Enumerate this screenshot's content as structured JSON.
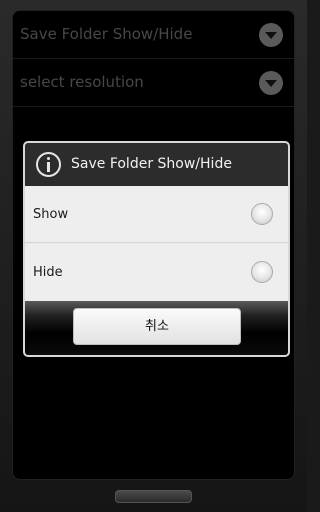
{
  "preferences": {
    "items": [
      {
        "label": "Save Folder Show/Hide",
        "icon": "dropdown-arrow-icon"
      },
      {
        "label": "select resolution",
        "icon": "dropdown-arrow-icon"
      }
    ]
  },
  "dialog": {
    "title": "Save Folder Show/Hide",
    "title_icon": "info-icon",
    "options": [
      {
        "label": "Show",
        "selected": false
      },
      {
        "label": "Hide",
        "selected": false
      }
    ],
    "cancel_label": "취소"
  },
  "colors": {
    "screen_background": "#000000",
    "pref_text": "#6e6e6e",
    "dialog_title_bar": "#2c2c2c",
    "dialog_body": "#eeeeee"
  }
}
